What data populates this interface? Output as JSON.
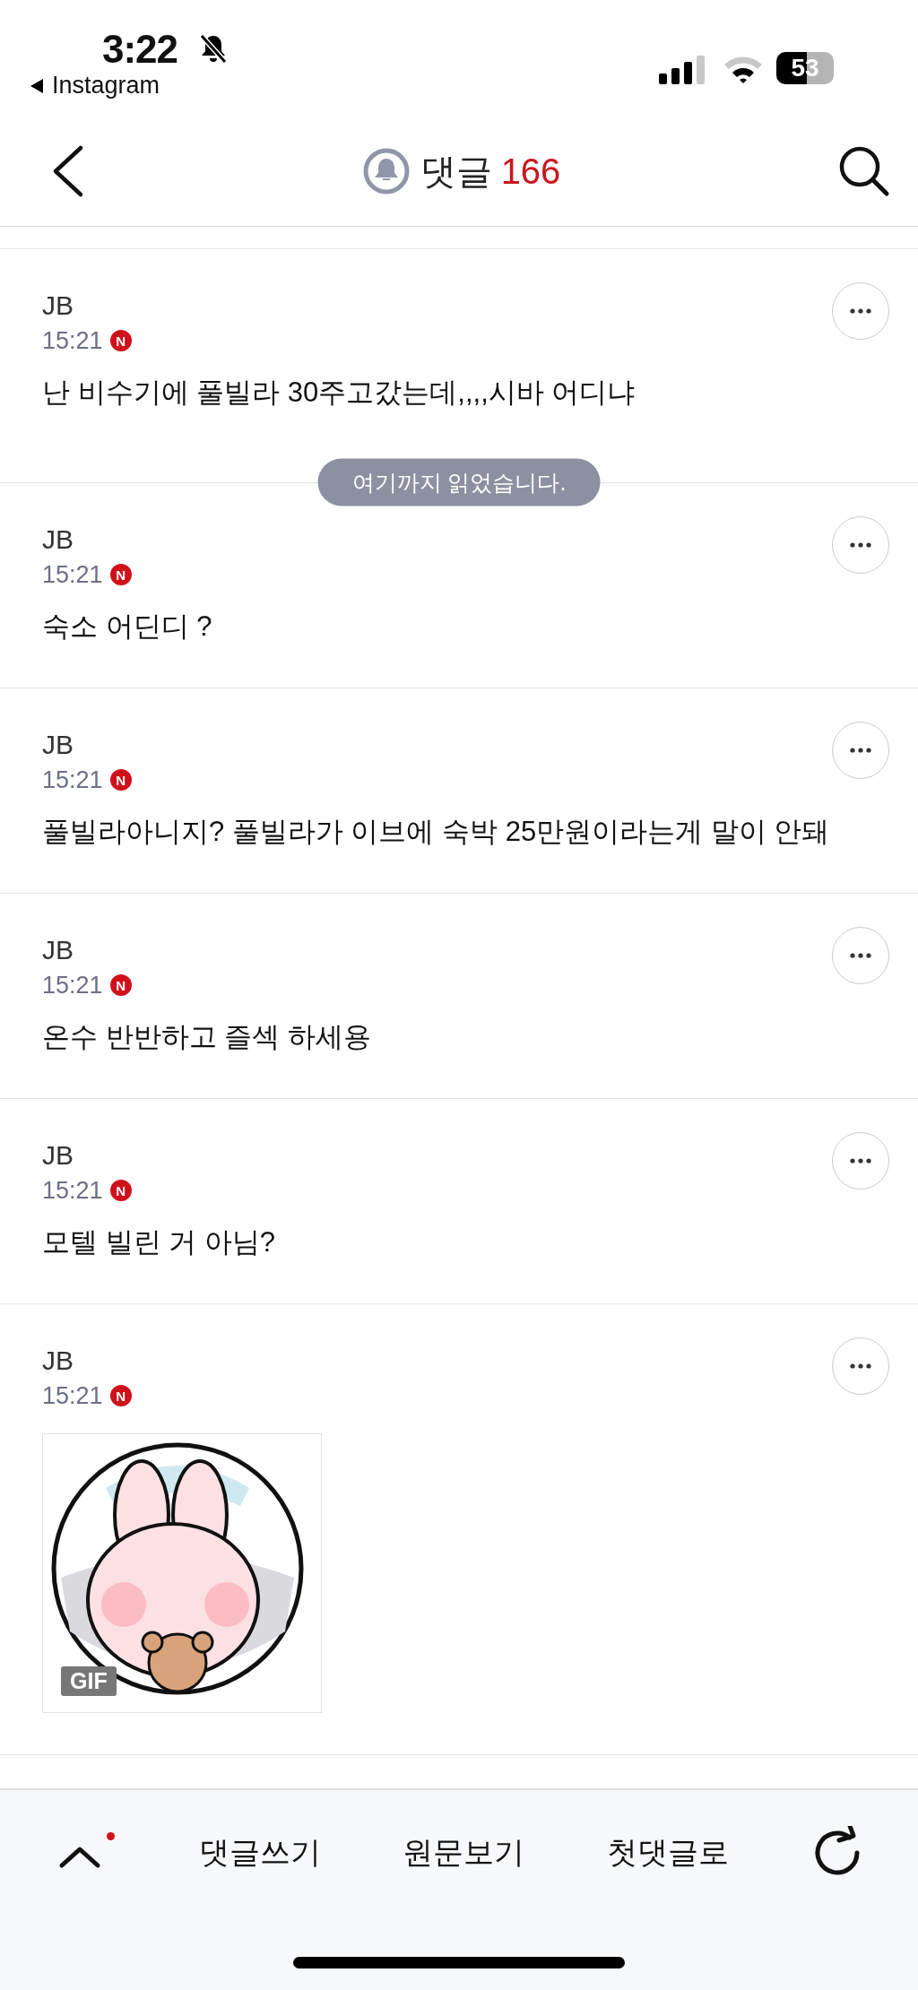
{
  "status_bar": {
    "time": "3:22",
    "back_app": "Instagram",
    "battery": "53"
  },
  "header": {
    "title": "댓글",
    "count": "166"
  },
  "comments": [
    {
      "kind": "text",
      "author": "JB",
      "time": "15:21",
      "badge": "N",
      "text": "난 비수기에 풀빌라 30주고갔는데,,,,시바 어디냐",
      "read_marker": "여기까지 읽었습니다."
    },
    {
      "kind": "text",
      "author": "JB",
      "time": "15:21",
      "badge": "N",
      "text": "숙소 어딘디 ?"
    },
    {
      "kind": "text",
      "author": "JB",
      "time": "15:21",
      "badge": "N",
      "text": "풀빌라아니지? 풀빌라가 이브에 숙박 25만원이라는게 말이 안돼"
    },
    {
      "kind": "text",
      "author": "JB",
      "time": "15:21",
      "badge": "N",
      "text": "온수 반반하고 즐섹 하세용"
    },
    {
      "kind": "text",
      "author": "JB",
      "time": "15:21",
      "badge": "N",
      "text": "모텔 빌린 거 아님?"
    },
    {
      "kind": "gif",
      "author": "JB",
      "time": "15:21",
      "badge": "N",
      "gif_label": "GIF"
    }
  ],
  "bottom_bar": {
    "up_unread": true,
    "actions": [
      "댓글쓰기",
      "원문보기",
      "첫댓글로"
    ]
  }
}
